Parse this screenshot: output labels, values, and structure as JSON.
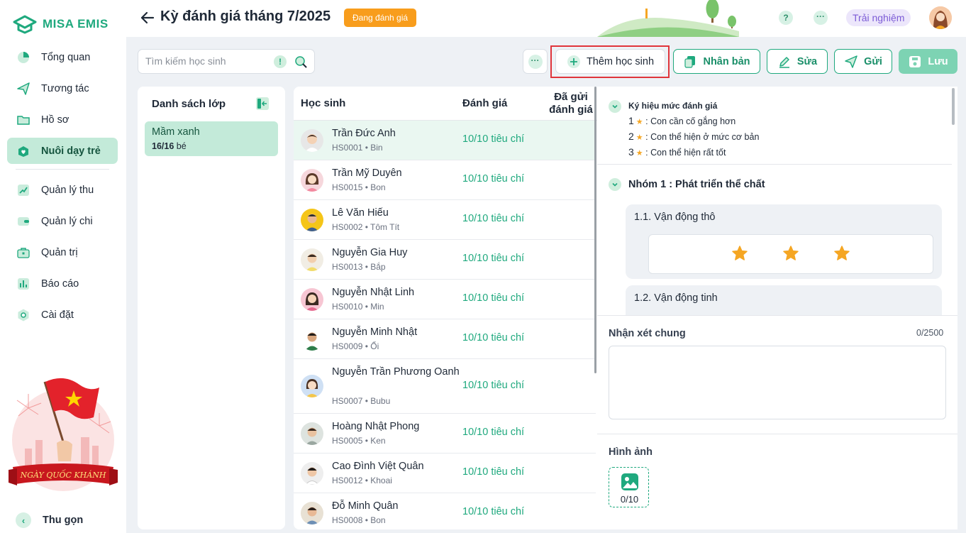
{
  "app": {
    "name": "MISA EMIS"
  },
  "sidebar": {
    "items": [
      {
        "label": "Tổng quan",
        "icon": "pie-chart-icon",
        "active": false
      },
      {
        "label": "Tương tác",
        "icon": "paper-plane-icon",
        "active": false
      },
      {
        "label": "Hồ sơ",
        "icon": "folder-icon",
        "active": false
      },
      {
        "label": "Nuôi dạy trẻ",
        "icon": "heart-box-icon",
        "active": true
      },
      {
        "label": "Quản lý thu",
        "icon": "trend-chart-icon",
        "active": false
      },
      {
        "label": "Quản lý chi",
        "icon": "wallet-icon",
        "active": false
      },
      {
        "label": "Quản trị",
        "icon": "briefcase-icon",
        "active": false
      },
      {
        "label": "Báo cáo",
        "icon": "bar-chart-icon",
        "active": false
      },
      {
        "label": "Cài đặt",
        "icon": "gear-icon",
        "active": false
      }
    ],
    "promo_text": "NGÀY QUỐC KHÁNH",
    "collapse_label": "Thu gọn"
  },
  "header": {
    "title": "Kỳ đánh giá tháng 7/2025",
    "status": "Đang đánh giá",
    "help": "?",
    "more": "···",
    "trial": "Trải nghiệm"
  },
  "toolbar": {
    "search_placeholder": "Tìm kiếm học sinh",
    "add_student": "Thêm học sinh",
    "duplicate": "Nhân bản",
    "edit": "Sửa",
    "send": "Gửi",
    "save": "Lưu"
  },
  "class_list": {
    "title": "Danh sách lớp",
    "classes": [
      {
        "name": "Mầm xanh",
        "count": "16/16",
        "unit": "bé"
      }
    ]
  },
  "students_table": {
    "headers": {
      "student": "Học sinh",
      "evaluation": "Đánh giá",
      "sent": "Đã gửi đánh giá"
    },
    "rows": [
      {
        "name": "Trần Đức Anh",
        "code": "HS0001 • Bin",
        "eval": "10/10 tiêu chí"
      },
      {
        "name": "Trần Mỹ Duyên",
        "code": "HS0015 • Bon",
        "eval": "10/10 tiêu chí"
      },
      {
        "name": "Lê Văn Hiếu",
        "code": "HS0002 • Tôm Tít",
        "eval": "10/10 tiêu chí"
      },
      {
        "name": "Nguyễn Gia Huy",
        "code": "HS0013 • Bắp",
        "eval": "10/10 tiêu chí"
      },
      {
        "name": "Nguyễn Nhật Linh",
        "code": "HS0010 • Min",
        "eval": "10/10 tiêu chí"
      },
      {
        "name": "Nguyễn Minh Nhật",
        "code": "HS0009 • Ổi",
        "eval": "10/10 tiêu chí"
      },
      {
        "name": "Nguyễn Trần Phương Oanh",
        "code": "HS0007 • Bubu",
        "eval": "10/10 tiêu chí"
      },
      {
        "name": "Hoàng Nhật Phong",
        "code": "HS0005 • Ken",
        "eval": "10/10 tiêu chí"
      },
      {
        "name": "Cao Đình Việt Quân",
        "code": "HS0012 • Khoai",
        "eval": "10/10 tiêu chí"
      },
      {
        "name": "Đỗ Minh Quân",
        "code": "HS0008 • Bon",
        "eval": "10/10 tiêu chí"
      }
    ]
  },
  "evaluation": {
    "legend": {
      "title": "Ký hiệu mức đánh giá",
      "levels": [
        {
          "num": "1",
          "text": ": Con cần cố gắng hơn"
        },
        {
          "num": "2",
          "text": ": Con thể hiện ở mức cơ bản"
        },
        {
          "num": "3",
          "text": ": Con thể hiện rất tốt"
        }
      ]
    },
    "group_title": "Nhóm 1 : Phát triển thể chất",
    "criteria": [
      {
        "title": "1.1. Vận động thô",
        "rating": 3
      },
      {
        "title": "1.2. Vận động tinh"
      }
    ],
    "comment_label": "Nhận xét chung",
    "comment_count": "0/2500",
    "image_label": "Hình ảnh",
    "image_count": "0/10"
  },
  "colors": {
    "brand": "#1fa97e",
    "accent_orange": "#f89d1c",
    "star": "#f5a623",
    "highlight": "#e0353b"
  }
}
